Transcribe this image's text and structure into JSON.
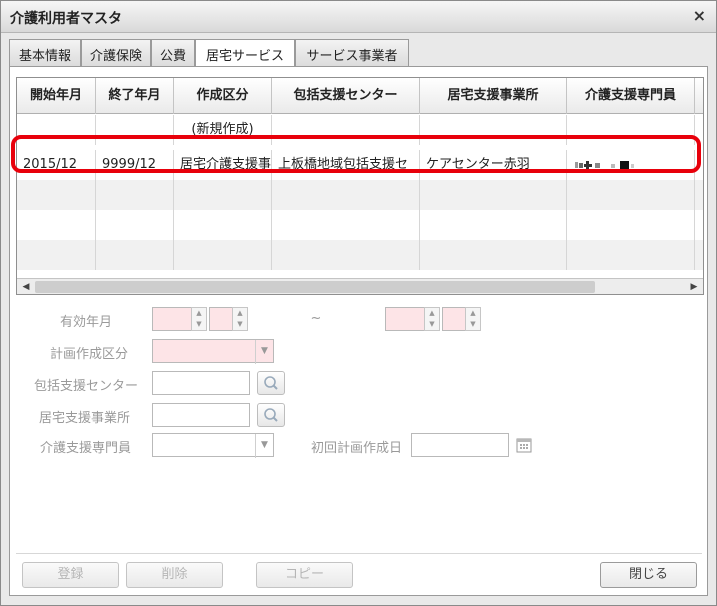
{
  "window": {
    "title": "介護利用者マスタ",
    "close_glyph": "×"
  },
  "tabs": [
    {
      "label": "基本情報",
      "active": false
    },
    {
      "label": "介護保険",
      "active": false
    },
    {
      "label": "公費",
      "active": false
    },
    {
      "label": "居宅サービス",
      "active": true
    },
    {
      "label": "サービス事業者",
      "active": false
    }
  ],
  "grid": {
    "columns": [
      "開始年月",
      "終了年月",
      "作成区分",
      "包括支援センター",
      "居宅支援事業所",
      "介護支援専門員"
    ],
    "new_row_label": "(新規作成)",
    "rows": [
      {
        "start": "2015/12",
        "end": "9999/12",
        "kind": "居宅介護支援事",
        "center": "上板橋地域包括支援セ",
        "office": "ケアセンター赤羽",
        "manager": ""
      }
    ],
    "highlight_color": "#e8000b"
  },
  "form": {
    "valid_period_label": "有効年月",
    "range_separator": "~",
    "plan_kind_label": "計画作成区分",
    "center_label": "包括支援センター",
    "office_label": "居宅支援事業所",
    "manager_label": "介護支援専門員",
    "first_plan_label": "初回計画作成日"
  },
  "buttons": {
    "register": "登録",
    "delete": "削除",
    "copy": "コピー",
    "close": "閉じる"
  },
  "icons": {
    "search": "search-icon",
    "calendar": "calendar-icon",
    "dropdown": "chevron-down-icon"
  }
}
